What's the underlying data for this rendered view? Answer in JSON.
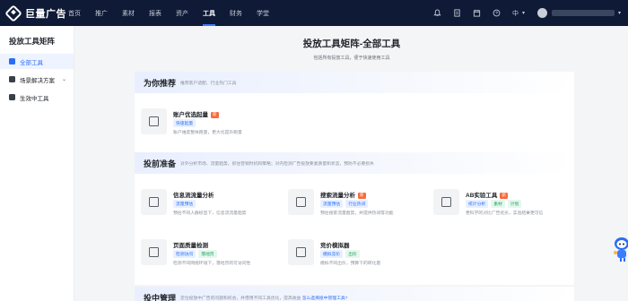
{
  "header": {
    "logo_text": "巨量广告",
    "nav": [
      "首页",
      "推广",
      "素材",
      "报表",
      "资产",
      "工具",
      "财务",
      "学堂"
    ],
    "active_nav": "工具",
    "lang": "中"
  },
  "sidebar": {
    "title": "投放工具矩阵",
    "items": [
      {
        "label": "全部工具",
        "icon": "grid-icon",
        "active": true
      },
      {
        "label": "场景解决方案",
        "icon": "solution-icon",
        "has_caret": true
      },
      {
        "label": "生效中工具",
        "icon": "monitor-icon"
      }
    ]
  },
  "page": {
    "title": "投放工具矩阵-全部工具",
    "subtitle": "包括所有投放工具，便于快速使用工具"
  },
  "sections": {
    "recommend": {
      "title": "为你推荐",
      "desc": "推荐客户适配、行业热门工具",
      "tools": [
        {
          "name": "账户优选起量",
          "is_new": true,
          "tags": [
            {
              "text": "快速起量",
              "color": "blue"
            }
          ],
          "desc": "账户维度整体跑量，更大化提升跑量"
        }
      ]
    },
    "pre": {
      "title": "投前准备",
      "desc": "对外分析市场、流量趋势，抓住营销时机和策略；对内检测广告投放要素质量和状态，预防不必要损失",
      "tools": [
        {
          "name": "信息流流量分析",
          "is_new": false,
          "tags": [
            {
              "text": "流量预估",
              "color": "blue"
            }
          ],
          "desc": "预估不同人群标签下，信息流流量趋势"
        },
        {
          "name": "搜索流量分析",
          "is_new": true,
          "tags": [
            {
              "text": "流量预估",
              "color": "blue"
            },
            {
              "text": "行业热词",
              "color": "blue"
            }
          ],
          "desc": "预估搜索流量趋势，并提供热词等功能"
        },
        {
          "name": "AB实验工具",
          "is_new": true,
          "tags": [
            {
              "text": "统计分析",
              "color": "blue"
            },
            {
              "text": "素材",
              "color": "green"
            },
            {
              "text": "计划",
              "color": "green"
            }
          ],
          "desc": "更科学的对比广告优劣，实验结果更可信"
        },
        {
          "name": "页面质量检测",
          "is_new": false,
          "tags": [
            {
              "text": "检测访问",
              "color": "blue"
            },
            {
              "text": "落地页",
              "color": "green"
            }
          ],
          "desc": "检测不同网络环境下，落地页的可访问性"
        },
        {
          "name": "竞价模拟器",
          "is_new": false,
          "tags": [
            {
              "text": "模拟竞价",
              "color": "blue"
            },
            {
              "text": "出价",
              "color": "green"
            }
          ],
          "desc": "模拟不同出价，预算下的转化量"
        }
      ]
    },
    "mid": {
      "title": "投中管理",
      "desc": "定位投放中广告的问题和机会，并借用不同工具优化，提高收益",
      "link": "怎么选择投中管理工具?"
    }
  }
}
